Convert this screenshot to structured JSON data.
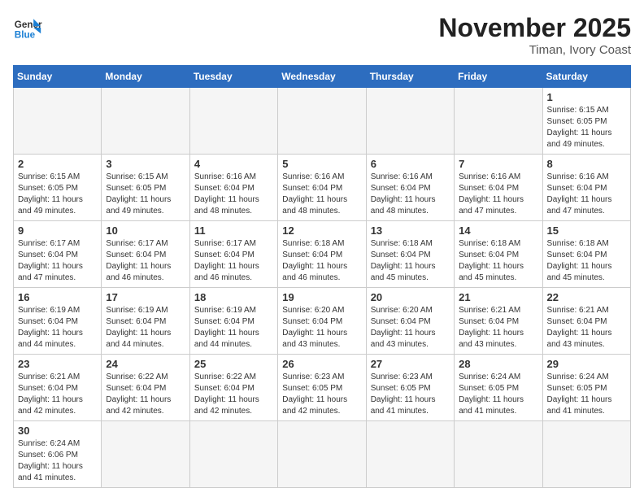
{
  "header": {
    "logo_general": "General",
    "logo_blue": "Blue",
    "month_title": "November 2025",
    "subtitle": "Timan, Ivory Coast"
  },
  "days_of_week": [
    "Sunday",
    "Monday",
    "Tuesday",
    "Wednesday",
    "Thursday",
    "Friday",
    "Saturday"
  ],
  "weeks": [
    [
      {
        "day": "",
        "info": ""
      },
      {
        "day": "",
        "info": ""
      },
      {
        "day": "",
        "info": ""
      },
      {
        "day": "",
        "info": ""
      },
      {
        "day": "",
        "info": ""
      },
      {
        "day": "",
        "info": ""
      },
      {
        "day": "1",
        "info": "Sunrise: 6:15 AM\nSunset: 6:05 PM\nDaylight: 11 hours\nand 49 minutes."
      }
    ],
    [
      {
        "day": "2",
        "info": "Sunrise: 6:15 AM\nSunset: 6:05 PM\nDaylight: 11 hours\nand 49 minutes."
      },
      {
        "day": "3",
        "info": "Sunrise: 6:15 AM\nSunset: 6:05 PM\nDaylight: 11 hours\nand 49 minutes."
      },
      {
        "day": "4",
        "info": "Sunrise: 6:16 AM\nSunset: 6:04 PM\nDaylight: 11 hours\nand 48 minutes."
      },
      {
        "day": "5",
        "info": "Sunrise: 6:16 AM\nSunset: 6:04 PM\nDaylight: 11 hours\nand 48 minutes."
      },
      {
        "day": "6",
        "info": "Sunrise: 6:16 AM\nSunset: 6:04 PM\nDaylight: 11 hours\nand 48 minutes."
      },
      {
        "day": "7",
        "info": "Sunrise: 6:16 AM\nSunset: 6:04 PM\nDaylight: 11 hours\nand 47 minutes."
      },
      {
        "day": "8",
        "info": "Sunrise: 6:16 AM\nSunset: 6:04 PM\nDaylight: 11 hours\nand 47 minutes."
      }
    ],
    [
      {
        "day": "9",
        "info": "Sunrise: 6:17 AM\nSunset: 6:04 PM\nDaylight: 11 hours\nand 47 minutes."
      },
      {
        "day": "10",
        "info": "Sunrise: 6:17 AM\nSunset: 6:04 PM\nDaylight: 11 hours\nand 46 minutes."
      },
      {
        "day": "11",
        "info": "Sunrise: 6:17 AM\nSunset: 6:04 PM\nDaylight: 11 hours\nand 46 minutes."
      },
      {
        "day": "12",
        "info": "Sunrise: 6:18 AM\nSunset: 6:04 PM\nDaylight: 11 hours\nand 46 minutes."
      },
      {
        "day": "13",
        "info": "Sunrise: 6:18 AM\nSunset: 6:04 PM\nDaylight: 11 hours\nand 45 minutes."
      },
      {
        "day": "14",
        "info": "Sunrise: 6:18 AM\nSunset: 6:04 PM\nDaylight: 11 hours\nand 45 minutes."
      },
      {
        "day": "15",
        "info": "Sunrise: 6:18 AM\nSunset: 6:04 PM\nDaylight: 11 hours\nand 45 minutes."
      }
    ],
    [
      {
        "day": "16",
        "info": "Sunrise: 6:19 AM\nSunset: 6:04 PM\nDaylight: 11 hours\nand 44 minutes."
      },
      {
        "day": "17",
        "info": "Sunrise: 6:19 AM\nSunset: 6:04 PM\nDaylight: 11 hours\nand 44 minutes."
      },
      {
        "day": "18",
        "info": "Sunrise: 6:19 AM\nSunset: 6:04 PM\nDaylight: 11 hours\nand 44 minutes."
      },
      {
        "day": "19",
        "info": "Sunrise: 6:20 AM\nSunset: 6:04 PM\nDaylight: 11 hours\nand 43 minutes."
      },
      {
        "day": "20",
        "info": "Sunrise: 6:20 AM\nSunset: 6:04 PM\nDaylight: 11 hours\nand 43 minutes."
      },
      {
        "day": "21",
        "info": "Sunrise: 6:21 AM\nSunset: 6:04 PM\nDaylight: 11 hours\nand 43 minutes."
      },
      {
        "day": "22",
        "info": "Sunrise: 6:21 AM\nSunset: 6:04 PM\nDaylight: 11 hours\nand 43 minutes."
      }
    ],
    [
      {
        "day": "23",
        "info": "Sunrise: 6:21 AM\nSunset: 6:04 PM\nDaylight: 11 hours\nand 42 minutes."
      },
      {
        "day": "24",
        "info": "Sunrise: 6:22 AM\nSunset: 6:04 PM\nDaylight: 11 hours\nand 42 minutes."
      },
      {
        "day": "25",
        "info": "Sunrise: 6:22 AM\nSunset: 6:04 PM\nDaylight: 11 hours\nand 42 minutes."
      },
      {
        "day": "26",
        "info": "Sunrise: 6:23 AM\nSunset: 6:05 PM\nDaylight: 11 hours\nand 42 minutes."
      },
      {
        "day": "27",
        "info": "Sunrise: 6:23 AM\nSunset: 6:05 PM\nDaylight: 11 hours\nand 41 minutes."
      },
      {
        "day": "28",
        "info": "Sunrise: 6:24 AM\nSunset: 6:05 PM\nDaylight: 11 hours\nand 41 minutes."
      },
      {
        "day": "29",
        "info": "Sunrise: 6:24 AM\nSunset: 6:05 PM\nDaylight: 11 hours\nand 41 minutes."
      }
    ],
    [
      {
        "day": "30",
        "info": "Sunrise: 6:24 AM\nSunset: 6:06 PM\nDaylight: 11 hours\nand 41 minutes."
      },
      {
        "day": "",
        "info": ""
      },
      {
        "day": "",
        "info": ""
      },
      {
        "day": "",
        "info": ""
      },
      {
        "day": "",
        "info": ""
      },
      {
        "day": "",
        "info": ""
      },
      {
        "day": "",
        "info": ""
      }
    ]
  ]
}
